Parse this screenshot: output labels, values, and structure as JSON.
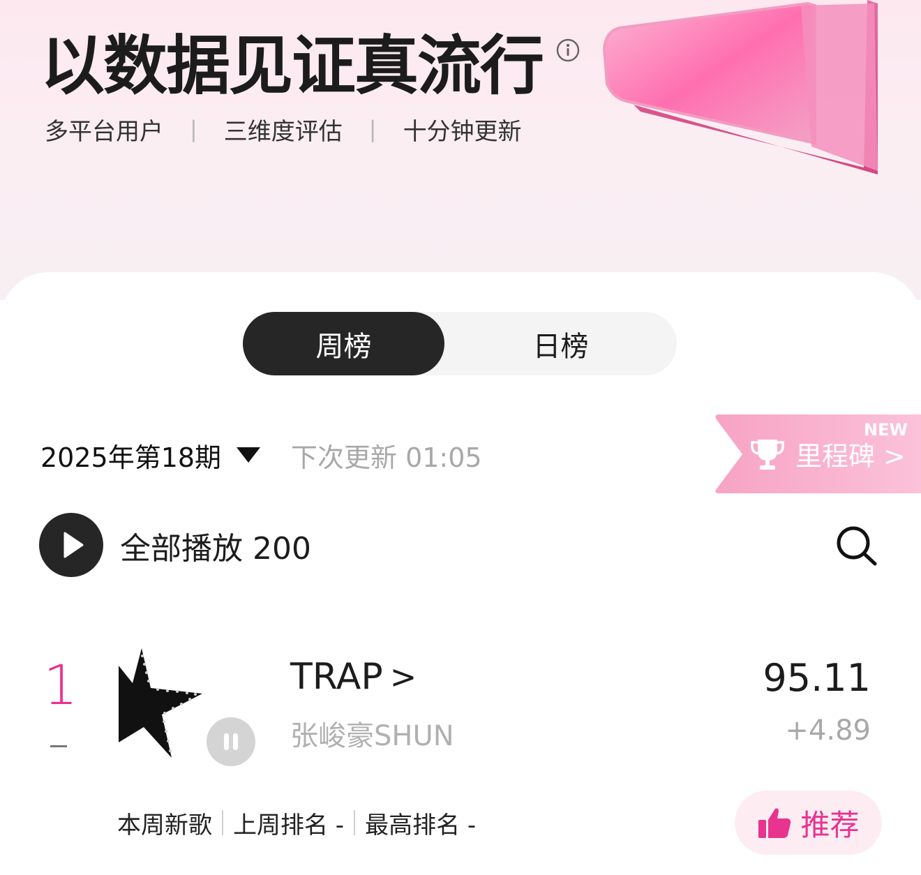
{
  "hero": {
    "title": "以数据见证真流行",
    "features": [
      "多平台用户",
      "三维度评估",
      "十分钟更新"
    ],
    "separator": "|"
  },
  "tabs": [
    {
      "label": "周榜",
      "active": true
    },
    {
      "label": "日榜",
      "active": false
    }
  ],
  "period": {
    "label": "2025年第18期",
    "next_update": "下次更新 01:05"
  },
  "milestone": {
    "label": "里程碑",
    "chevron": ">",
    "badge": "NEW",
    "icon": "trophy-icon"
  },
  "play_all": {
    "label": "全部播放 200"
  },
  "chart": {
    "entries": [
      {
        "rank": "1",
        "change": "–",
        "title": "TRAP",
        "title_chevron": ">",
        "artist": "张峻豪SHUN",
        "score": "95.11",
        "delta": "+4.89",
        "meta": [
          "本周新歌",
          "上周排名 -",
          "最高排名 -"
        ],
        "recommend_label": "推荐"
      }
    ]
  },
  "colors": {
    "accent_pink": "#e8338f",
    "dark": "#262626",
    "muted": "#a8a8a8",
    "hero_bg": "#fde8f0"
  }
}
